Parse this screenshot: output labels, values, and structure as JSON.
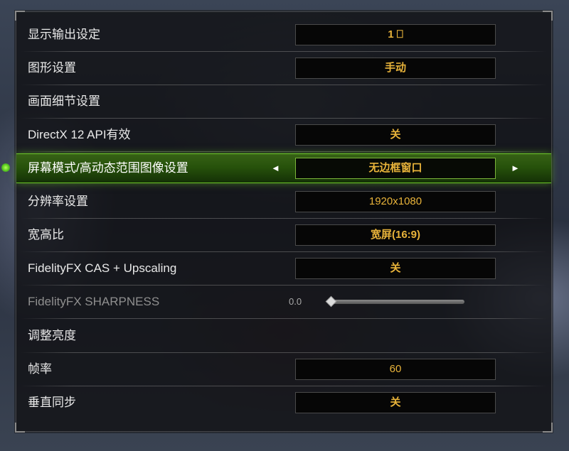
{
  "settings": [
    {
      "label": "显示输出设定",
      "value": "1 ⎕"
    },
    {
      "label": "图形设置",
      "value": "手动"
    },
    {
      "label": "画面细节设置",
      "value": null
    },
    {
      "label": "DirectX 12 API有效",
      "value": "关"
    },
    {
      "label": "屏幕模式/高动态范围图像设置",
      "value": "无边框窗口",
      "selected": true
    },
    {
      "label": "分辨率设置",
      "value": "1920x1080"
    },
    {
      "label": "宽高比",
      "value": "宽屏(16:9)"
    },
    {
      "label": "FidelityFX CAS + Upscaling",
      "value": "关"
    },
    {
      "label": "FidelityFX SHARPNESS",
      "slider_value_text": "0.0",
      "slider_fraction": 0.0,
      "disabled": true
    },
    {
      "label": "调整亮度",
      "value": null
    },
    {
      "label": "帧率",
      "value": "60"
    },
    {
      "label": "垂直同步",
      "value": "关"
    }
  ],
  "arrows": {
    "left": "◄",
    "right": "►"
  },
  "colors": {
    "value_text": "#e8b33a",
    "selected_row": "#3f7a12",
    "label_text": "#e9e9e9",
    "disabled_text": "#8f8f8f"
  }
}
